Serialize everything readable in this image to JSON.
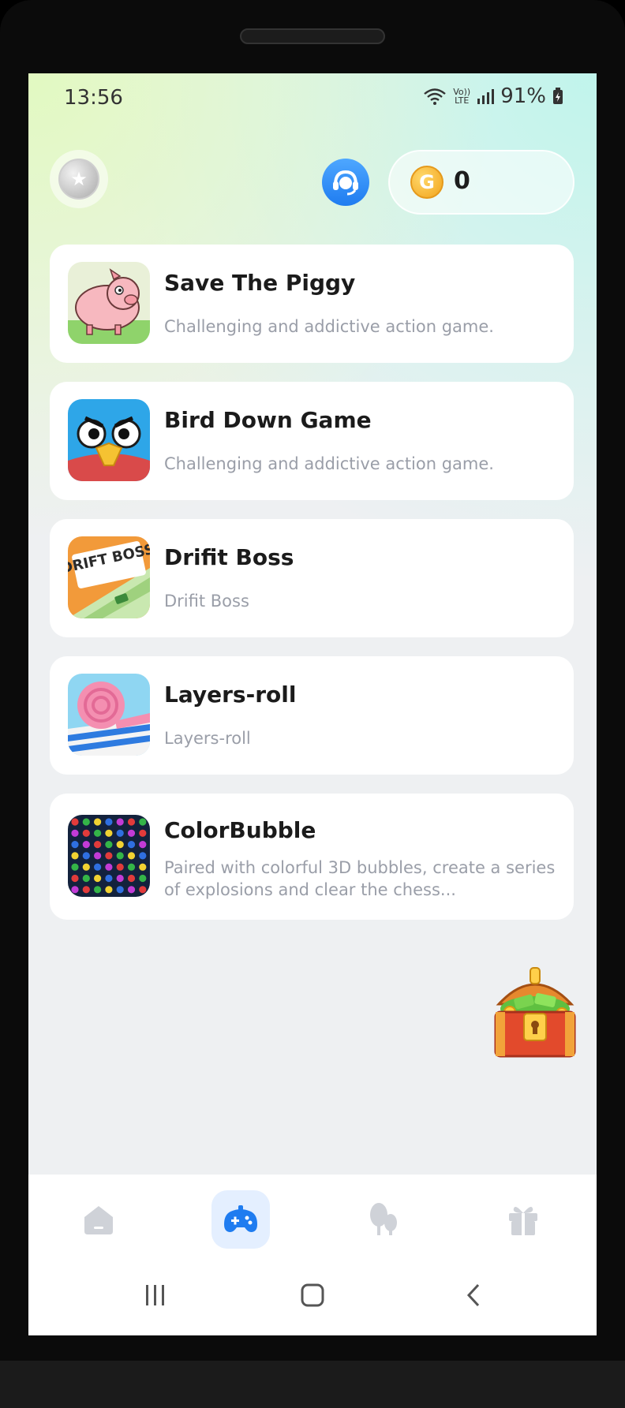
{
  "status_bar": {
    "time": "13:56",
    "network": "LTE",
    "battery": "91%"
  },
  "header": {
    "coin_symbol": "G",
    "coin_balance": "0"
  },
  "games": [
    {
      "title": "Save The Piggy",
      "description": "Challenging and addictive action game.",
      "icon": "pig-icon"
    },
    {
      "title": "Bird Down Game",
      "description": "Challenging and addictive action game.",
      "icon": "bird-icon"
    },
    {
      "title": "Drifit Boss",
      "description": "Drifit Boss",
      "icon": "drift-boss-icon",
      "icon_text": "DRIFT BOSS"
    },
    {
      "title": "Layers-roll",
      "description": "Layers-roll",
      "icon": "layers-roll-icon"
    },
    {
      "title": "ColorBubble",
      "description": "Paired with colorful 3D bubbles, create a series of explosions and clear the chess...",
      "icon": "color-bubble-icon"
    }
  ],
  "bottom_nav": [
    {
      "icon": "home-icon",
      "active": false
    },
    {
      "icon": "gamepad-icon",
      "active": true
    },
    {
      "icon": "tree-icon",
      "active": false
    },
    {
      "icon": "gift-icon",
      "active": false
    }
  ],
  "colors": {
    "accent": "#1f7cf0",
    "title": "#1b1b1b",
    "description": "#9a9ea8",
    "background": "#eef0f2"
  }
}
